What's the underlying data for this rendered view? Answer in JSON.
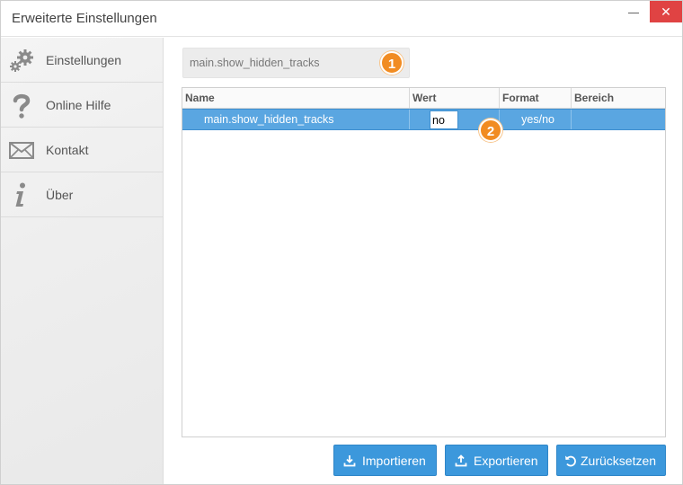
{
  "window": {
    "title": "Erweiterte Einstellungen",
    "close_glyph": "✕"
  },
  "sidebar": {
    "items": [
      {
        "label": "Einstellungen",
        "icon": "gears-icon"
      },
      {
        "label": "Online Hilfe",
        "icon": "question-icon"
      },
      {
        "label": "Kontakt",
        "icon": "envelope-icon"
      },
      {
        "label": "Über",
        "icon": "info-icon"
      }
    ]
  },
  "search": {
    "value": "main.show_hidden_tracks"
  },
  "badges": [
    "1",
    "2"
  ],
  "table": {
    "columns": [
      "Name",
      "Wert",
      "Format",
      "Bereich"
    ],
    "rows": [
      {
        "name": "main.show_hidden_tracks",
        "value": "no",
        "format": "yes/no",
        "range": ""
      }
    ]
  },
  "buttons": {
    "import": "Importieren",
    "export": "Exportieren",
    "reset": "Zurücksetzen"
  },
  "colors": {
    "accent": "#3c98dc",
    "selection": "#5aa6e1",
    "badge": "#f18c22",
    "close": "#e04343"
  }
}
